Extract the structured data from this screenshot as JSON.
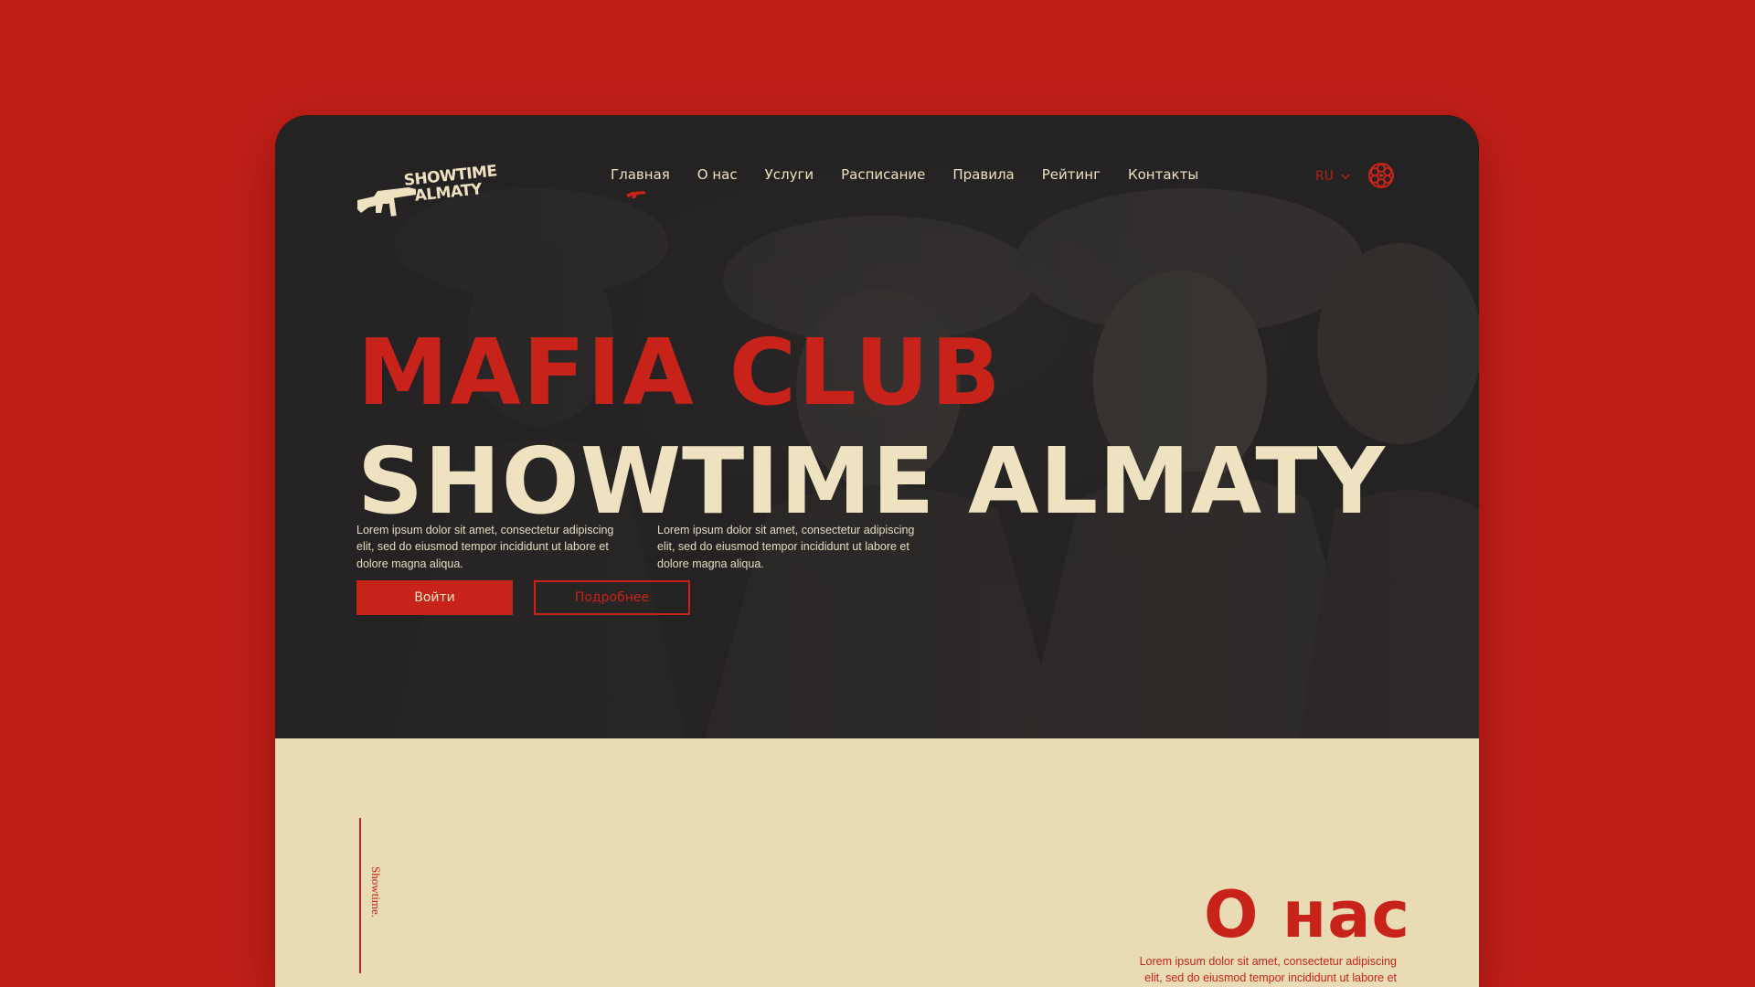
{
  "colors": {
    "background": "#c01f18",
    "dark": "#242222",
    "accent_red": "#c7231a",
    "cream": "#efe2c0",
    "paper": "#e9dcb4"
  },
  "logo": {
    "line1": "SHOWTIME",
    "line2": "ALMATY",
    "icon": "tommy-gun-icon"
  },
  "nav": {
    "items": [
      {
        "label": "Главная",
        "active": true
      },
      {
        "label": "О нас"
      },
      {
        "label": "Услуги"
      },
      {
        "label": "Расписание"
      },
      {
        "label": "Правила"
      },
      {
        "label": "Рейтинг"
      },
      {
        "label": "Контакты"
      }
    ],
    "language": "RU",
    "lang_icon": "chevron-down-icon",
    "extra_icon": "revolver-cylinder-icon"
  },
  "hero": {
    "title_line1": "MAFIA CLUB",
    "title_line2": "SHOWTIME ALMATY",
    "paragraph_left": "Lorem ipsum dolor  sit amet, consectetur adipiscing elit, sed do eiusmod tempor incididunt  ut labore et dolore magna aliqua.",
    "paragraph_right": "Lorem ipsum dolor  sit amet, consectetur adipiscing elit, sed do eiusmod tempor incididunt  ut labore et dolore magna aliqua.",
    "primary_button": "Войти",
    "secondary_button": "Подробнее"
  },
  "about": {
    "vertical_label": "Showtime.",
    "heading": "О нас",
    "text": "Lorem ipsum dolor  sit amet, consectetur adipiscing elit, sed do eiusmod tempor incididunt  ut labore et dolore magna aliqua."
  }
}
